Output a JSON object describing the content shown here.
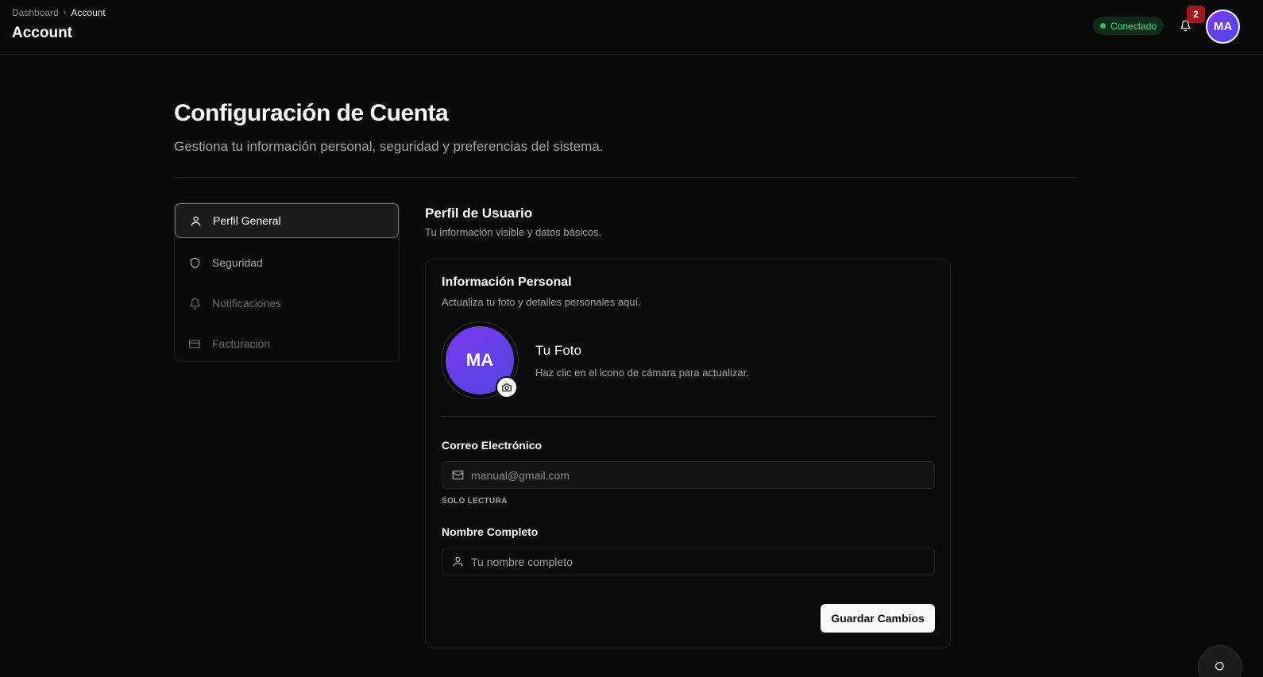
{
  "header": {
    "breadcrumb": [
      "Dashboard",
      "Account"
    ],
    "title": "Account",
    "status": "Conectado",
    "notifications_count": "2",
    "user_initials": "MA"
  },
  "page": {
    "title": "Configuración de Cuenta",
    "subtitle": "Gestiona tu información personal, seguridad y preferencias del sistema."
  },
  "sidebar": {
    "items": [
      {
        "label": "Perfil General",
        "icon": "user-icon",
        "active": true
      },
      {
        "label": "Seguridad",
        "icon": "shield-icon"
      },
      {
        "label": "Notificaciones",
        "icon": "bell-icon"
      },
      {
        "label": "Facturación",
        "icon": "credit-card-icon"
      }
    ]
  },
  "section": {
    "title": "Perfil de Usuario",
    "subtitle": "Tu información visible y datos básicos."
  },
  "card": {
    "title": "Información Personal",
    "subtitle": "Actualiza tu foto y detalles personales aquí.",
    "photo": {
      "initials": "MA",
      "title": "Tu Foto",
      "subtitle": "Haz clic en el icono de cámara para actualizar."
    },
    "email": {
      "label": "Correo Electrónico",
      "value": "manual@gmail.com",
      "note": "SOLO LECTURA"
    },
    "name": {
      "label": "Nombre Completo",
      "placeholder": "Tu nombre completo",
      "value": ""
    },
    "save_label": "Guardar Cambios"
  },
  "colors": {
    "background": "#0a0a0a",
    "accent": "#7c3aed",
    "status": "#22c55e",
    "badge": "#991b1b"
  }
}
